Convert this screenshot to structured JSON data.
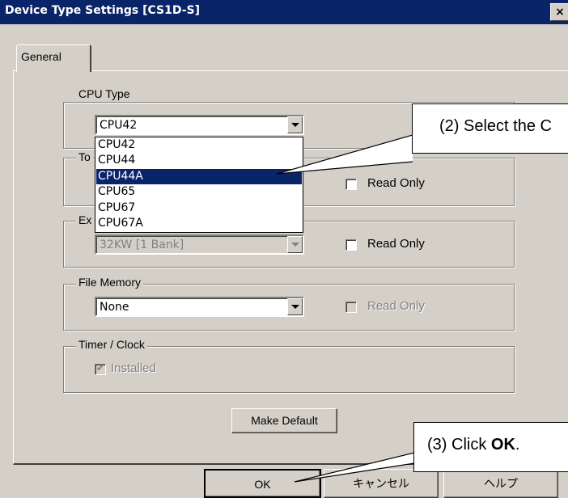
{
  "window": {
    "title": "Device Type Settings [CS1D-S]",
    "close_glyph": "×"
  },
  "tabs": [
    {
      "label": "General"
    }
  ],
  "cpu_type": {
    "legend": "CPU Type",
    "value": "CPU42",
    "options": [
      "CPU42",
      "CPU44",
      "CPU44A",
      "CPU65",
      "CPU67",
      "CPU67A"
    ],
    "highlighted": "CPU44A"
  },
  "to_group": {
    "legend_visible": "To",
    "read_only_label": "Read Only"
  },
  "ex_group": {
    "legend_visible": "Ex",
    "value": "32KW [1 Bank]",
    "read_only_label": "Read Only"
  },
  "file_memory": {
    "legend": "File Memory",
    "value": "None",
    "read_only_label": "Read Only"
  },
  "timer_clock": {
    "legend": "Timer / Clock",
    "installed_label": "Installed",
    "installed_checked": true
  },
  "buttons": {
    "make_default": "Make Default",
    "ok": "OK",
    "cancel": "キャンセル",
    "help": "ヘルプ"
  },
  "callouts": {
    "select_cpu": "(2) Select the C",
    "click_ok_prefix": "(3) Click ",
    "click_ok_bold": "OK",
    "click_ok_suffix": "."
  }
}
